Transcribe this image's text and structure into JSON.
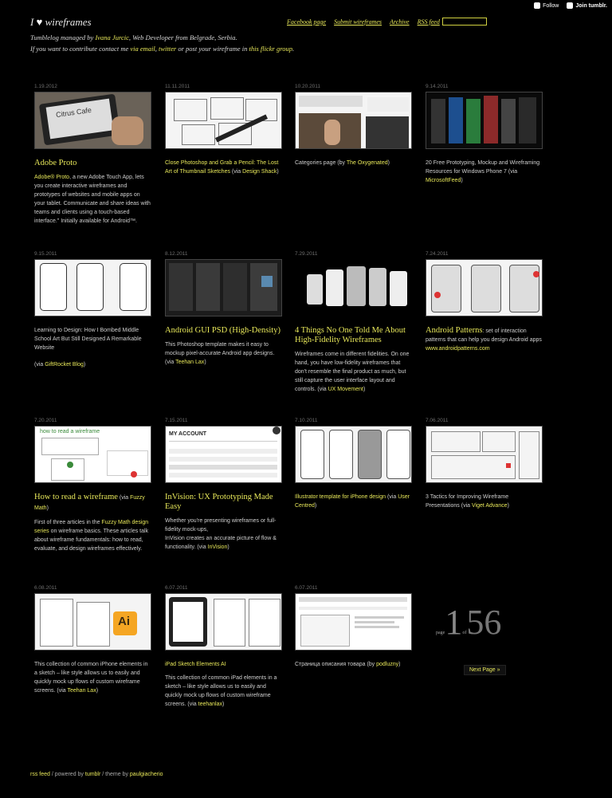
{
  "tumblr_bar": {
    "follow": "Follow",
    "join": "Join tumblr."
  },
  "site": {
    "title_prefix": "I",
    "title_suffix": "wireframes",
    "tagline1_pre": "Tumblelog managed by ",
    "tagline1_link": "Ivana Jurcic",
    "tagline1_post": ", Web Developer from Belgrade, Serbia.",
    "tagline2_pre": "If you want to contribute contact me ",
    "tagline2_link1": "via email",
    "tagline2_sep": ", ",
    "tagline2_link2": "twitter",
    "tagline2_mid": " or post your wireframe in ",
    "tagline2_link3": "this flickr group",
    "tagline2_end": "."
  },
  "nav": [
    "Facebook page",
    "Submit wireframes",
    "Archive",
    "RSS feed"
  ],
  "posts": [
    {
      "date": "1.19.2012",
      "title": "Adobe Proto",
      "text_link": "Adobe® Proto",
      "text": ", a new Adobe Touch App, lets you create interactive wireframes and prototypes of websites and mobile apps on your tablet. Communicate and share ideas with teams and clients using a touch-based interface.\" Initially available for Android™.",
      "thumb_label": "Citrus Cafe"
    },
    {
      "date": "11.11.2011",
      "link_title": "Close Photoshop and Grab a Pencil: The Lost Art of Thumbnail Sketches",
      "via_pre": " (via ",
      "via": "Design Shack",
      "via_post": ")"
    },
    {
      "date": "10.20.2011",
      "pre": "Categories page (by ",
      "via": "The Oxygenated",
      "via_post": ")"
    },
    {
      "date": "9.14.2011",
      "pre": "20 Free Prototyping, Mockup and Wireframing Resources for Windows Phone 7 (via ",
      "via": "MicrosoftFeed",
      "via_post": ")"
    },
    {
      "date": "9.15.2011",
      "text": "Learning to Design: How I Bombed Middle School Art But Still Designed A Remarkable Website",
      "via_pre": "(via ",
      "via": "GiftRocket Blog",
      "via_post": ")"
    },
    {
      "date": "8.12.2011",
      "title": "Android GUI PSD (High-Density)",
      "text": "This Photoshop template makes it easy to mockup pixel-accurate Android app designs. (via ",
      "via": "Teehan Lax",
      "via_post": ")"
    },
    {
      "date": "7.29.2011",
      "title": "4 Things No One Told Me About High-Fidelity Wireframes",
      "text": "Wireframes come in different fidelities. On one hand, you have low-fidelity wireframes that don't resemble the final product as much, but still capture the user interface layout and controls. (via ",
      "via": "UX Movement",
      "via_post": ")"
    },
    {
      "date": "7.24.2011",
      "title": "Android Patterns",
      "title_post": ": set of interaction patterns that can help you design Android apps ",
      "link": "www.androidpatterns.com"
    },
    {
      "date": "7.20.2011",
      "title": "How to read a wireframe",
      "title_via_pre": " (via ",
      "title_via": "Fuzzy Math",
      "title_via_post": ")",
      "text_pre": "First of three articles in the ",
      "text_link": "Fuzzy Math design series",
      "text": " on wireframe basics. These articles talk about wireframe fundamentals: how to read, evaluate, and design wireframes effectively.",
      "thumb_label": "how to read a wireframe"
    },
    {
      "date": "7.15.2011",
      "title": "InVision: UX Prototyping Made Easy",
      "text": "Whether you're presenting wireframes or full-fidelity mock-ups,",
      "text2": "InVision creates an accurate picture of flow & functionality. (via ",
      "via": "InVision",
      "via_post": ")",
      "thumb_label": "MY ACCOUNT"
    },
    {
      "date": "7.10.2011",
      "link_title": "Illustrator template for iPhone design",
      "via_pre": " (via ",
      "via": "User Centred",
      "via_post": ")"
    },
    {
      "date": "7.06.2011",
      "text": "3 Tactics for Improving Wireframe Presentations (via ",
      "via": "Viget Advance",
      "via_post": ")"
    },
    {
      "date": "6.08.2011",
      "text": "This collection of common iPhone elements in a sketch – like style allows us to easily and quickly mock up flows of custom wireframe screens. (via ",
      "via": "Teehan Lax",
      "via_post": ")",
      "thumb_label": "Ai"
    },
    {
      "date": "6.07.2011",
      "link_title": "iPad Sketch Elements AI",
      "text": "This collection of common iPad elements in a sketch – like style allows us to easily and quickly mock up flows of custom wireframe screens. (via ",
      "via": "teehanlax",
      "via_post": ")"
    },
    {
      "date": "6.07.2011",
      "pre": "Страница описания товара (by ",
      "via": "podluzny",
      "via_post": ")"
    }
  ],
  "pager": {
    "label_page": "page",
    "current": "1",
    "label_of": "of",
    "total": "56",
    "next": "Next Page »"
  },
  "footer": {
    "rss": "rss feed",
    "sep1": " / powered by ",
    "tumblr": "tumblr",
    "sep2": " / theme by ",
    "author": "paulgiacherio"
  }
}
